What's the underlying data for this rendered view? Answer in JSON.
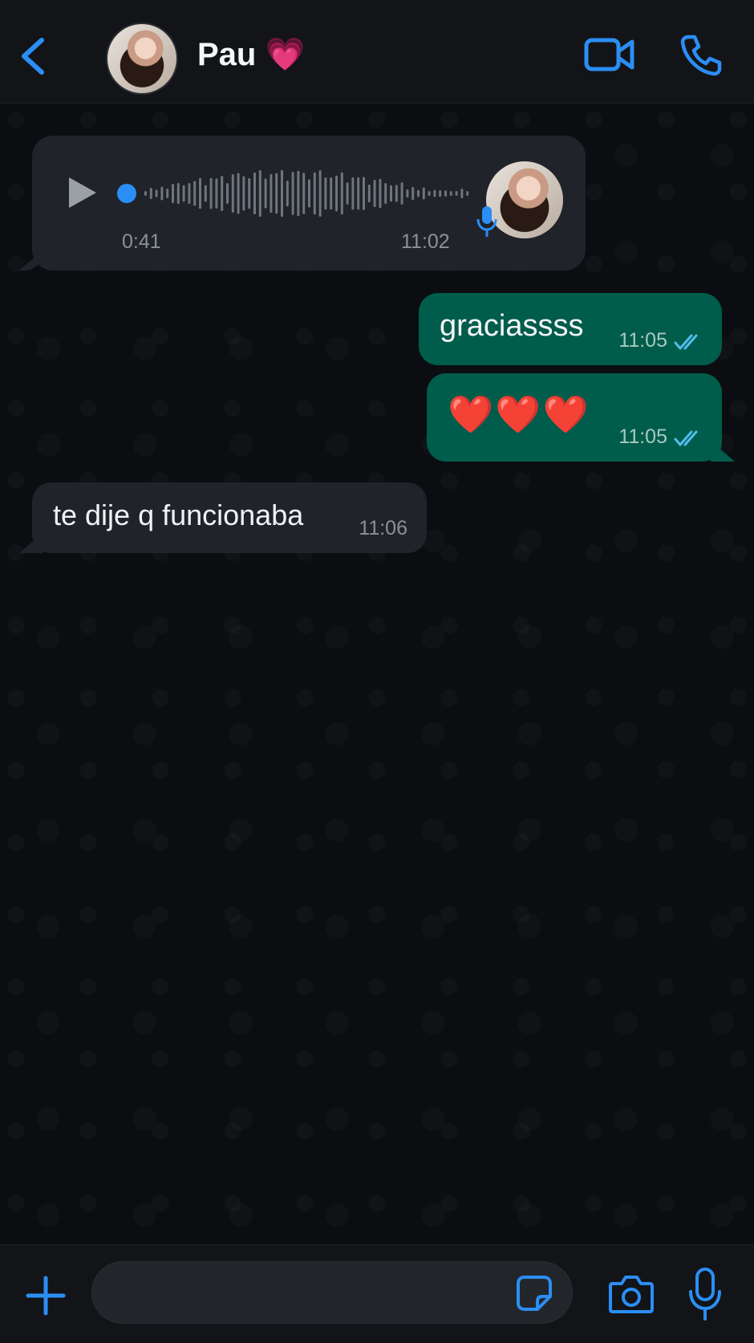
{
  "header": {
    "contact_name": "Pau 💗",
    "back_icon": "chevron-left-icon",
    "video_icon": "video-camera-icon",
    "call_icon": "phone-icon"
  },
  "messages": [
    {
      "type": "voice",
      "direction": "incoming",
      "duration": "0:41",
      "time": "11:02",
      "progress": 0
    },
    {
      "type": "text",
      "direction": "outgoing",
      "text": "graciassss",
      "time": "11:05",
      "status": "read"
    },
    {
      "type": "text",
      "direction": "outgoing",
      "text": "❤️❤️❤️",
      "time": "11:05",
      "status": "read"
    },
    {
      "type": "text",
      "direction": "incoming",
      "text": "te dije q funcionaba",
      "time": "11:06"
    }
  ],
  "composer": {
    "input_value": "",
    "plus_icon": "plus-icon",
    "sticker_icon": "sticker-icon",
    "camera_icon": "camera-icon",
    "mic_icon": "microphone-icon"
  },
  "colors": {
    "accent": "#2b8ef4",
    "outgoing_bubble": "#005c4b",
    "incoming_bubble": "#202329",
    "background": "#0b0d10",
    "read_ticks": "#53bdeb"
  }
}
